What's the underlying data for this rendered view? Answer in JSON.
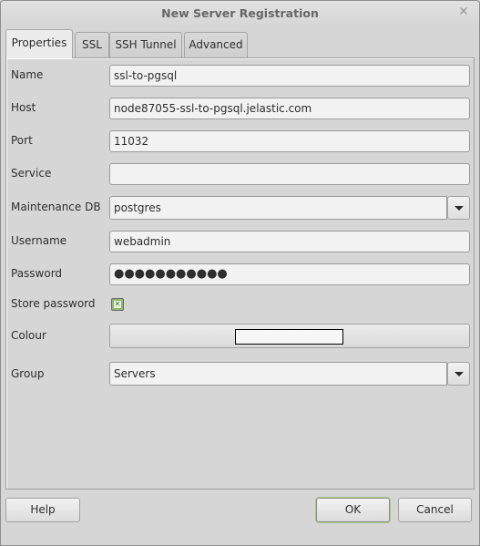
{
  "window": {
    "title": "New Server Registration",
    "close_icon": "close-icon"
  },
  "tabs": [
    {
      "label": "Properties",
      "active": true
    },
    {
      "label": "SSL",
      "active": false
    },
    {
      "label": "SSH Tunnel",
      "active": false
    },
    {
      "label": "Advanced",
      "active": false
    }
  ],
  "form": {
    "name": {
      "label": "Name",
      "value": "ssl-to-pgsql"
    },
    "host": {
      "label": "Host",
      "value": "node87055-ssl-to-pgsql.jelastic.com"
    },
    "port": {
      "label": "Port",
      "value": "11032"
    },
    "service": {
      "label": "Service",
      "value": ""
    },
    "maintenance_db": {
      "label": "Maintenance DB",
      "value": "postgres"
    },
    "username": {
      "label": "Username",
      "value": "webadmin"
    },
    "password": {
      "label": "Password",
      "value": "●●●●●●●●●●●"
    },
    "store_password": {
      "label": "Store password",
      "checked": true
    },
    "colour": {
      "label": "Colour",
      "value": "#f7f7f7"
    },
    "group": {
      "label": "Group",
      "value": "Servers"
    }
  },
  "buttons": {
    "help": "Help",
    "ok": "OK",
    "cancel": "Cancel"
  },
  "colors": {
    "accent": "#8db86a",
    "default_button_glow": "#a9cc86"
  }
}
